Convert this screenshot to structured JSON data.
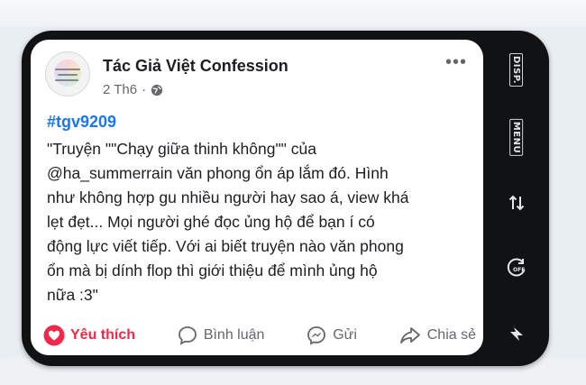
{
  "post": {
    "author": "Tác Giả Việt Confession",
    "date": "2 Th6",
    "hashtag": "#tgv9209",
    "lines": [
      "\"Truyện \"\"Chạy giữa thinh không\"\" của",
      "@ha_summerrain văn phong ổn áp lắm đó. Hình",
      "như không hợp gu nhiều người hay sao á, view khá",
      "lẹt đẹt... Mọi người ghé đọc ủng hộ để bạn í có",
      "động lực viết tiếp. Với ai biết truyện nào văn phong",
      "ổn mà bị dính flop thì giới thiệu để mình ủng hộ",
      "nữa :3\""
    ]
  },
  "actions": {
    "like": "Yêu thích",
    "comment": "Bình luận",
    "send": "Gửi",
    "share": "Chia sẻ"
  },
  "device_buttons": {
    "disp": "DISP.",
    "menu": "MENU",
    "off": "OFF"
  },
  "colors": {
    "like": "#f02849",
    "hashtag": "#1877f2",
    "device": "#101214"
  }
}
